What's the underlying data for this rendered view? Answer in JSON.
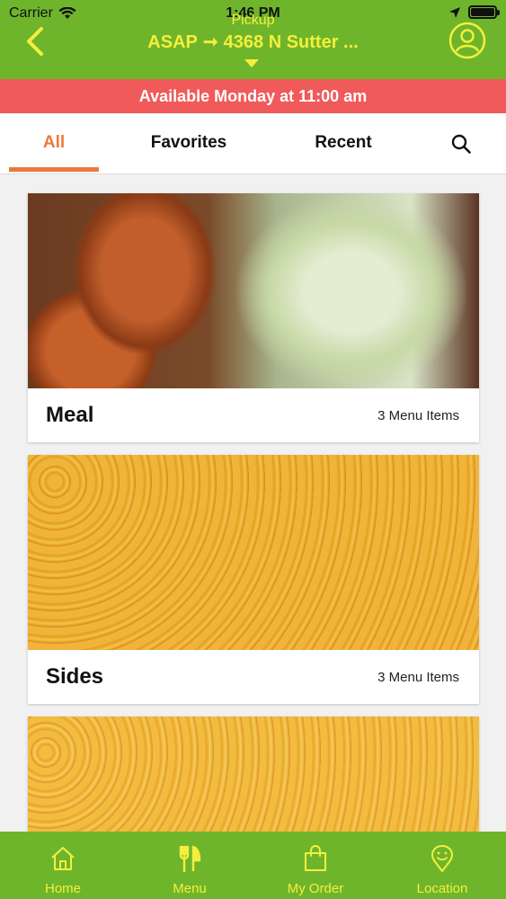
{
  "status_bar": {
    "carrier": "Carrier",
    "time": "1:46 PM"
  },
  "header": {
    "pickup_label": "Pickup",
    "when": "ASAP",
    "arrow": "➞",
    "address": "4368 N Sutter ...",
    "back_icon": "chevron-left-icon",
    "profile_icon": "user-circle-icon"
  },
  "banner": {
    "text": "Available Monday at 11:00 am"
  },
  "tabs": [
    {
      "label": "All",
      "active": true
    },
    {
      "label": "Favorites",
      "active": false
    },
    {
      "label": "Recent",
      "active": false
    }
  ],
  "categories": [
    {
      "title": "Meal",
      "count": "3 Menu Items",
      "image": "fried chicken with cabbage"
    },
    {
      "title": "Sides",
      "count": "3 Menu Items",
      "image": "macaroni and cheese"
    },
    {
      "title": "",
      "count": "",
      "image": "macaroni and cheese"
    }
  ],
  "bottom_nav": [
    {
      "label": "Home",
      "icon": "home-icon"
    },
    {
      "label": "Menu",
      "icon": "fork-knife-icon"
    },
    {
      "label": "My Order",
      "icon": "shopping-bag-icon"
    },
    {
      "label": "Location",
      "icon": "location-pin-icon"
    }
  ],
  "colors": {
    "primary": "#6fb52c",
    "accent_text": "#f4ef3c",
    "banner": "#f05a5a",
    "active_tab": "#ea7a3c"
  }
}
